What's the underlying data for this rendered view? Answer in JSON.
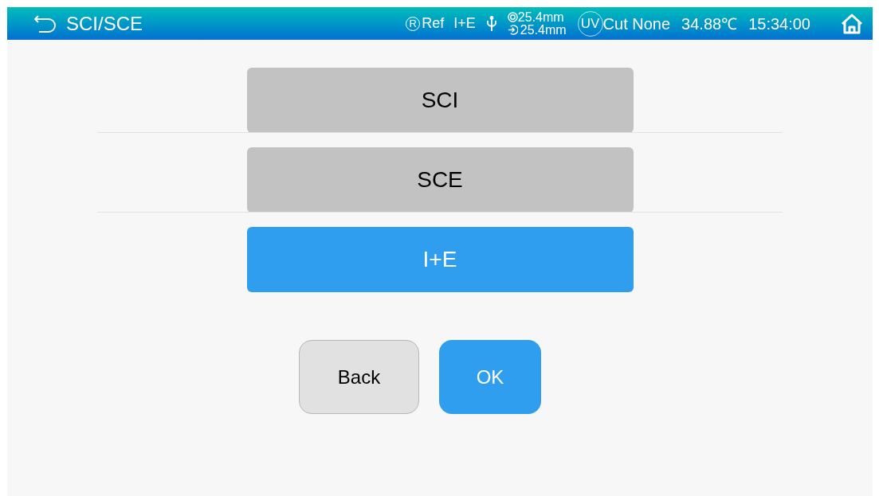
{
  "header": {
    "title": "SCI/SCE",
    "status": {
      "r_mark": "R",
      "ref": "Ref",
      "mode": "I+E",
      "aperture_1": "25.4mm",
      "aperture_2": "25.4mm",
      "uv_mark": "UV",
      "uv": "Cut None",
      "temperature": "34.88℃",
      "time": "15:34:00"
    }
  },
  "options": [
    {
      "label": "SCI",
      "selected": false
    },
    {
      "label": "SCE",
      "selected": false
    },
    {
      "label": "I+E",
      "selected": true
    }
  ],
  "buttons": [
    {
      "label": "Back",
      "kind": "secondary"
    },
    {
      "label": "OK",
      "kind": "primary"
    }
  ]
}
